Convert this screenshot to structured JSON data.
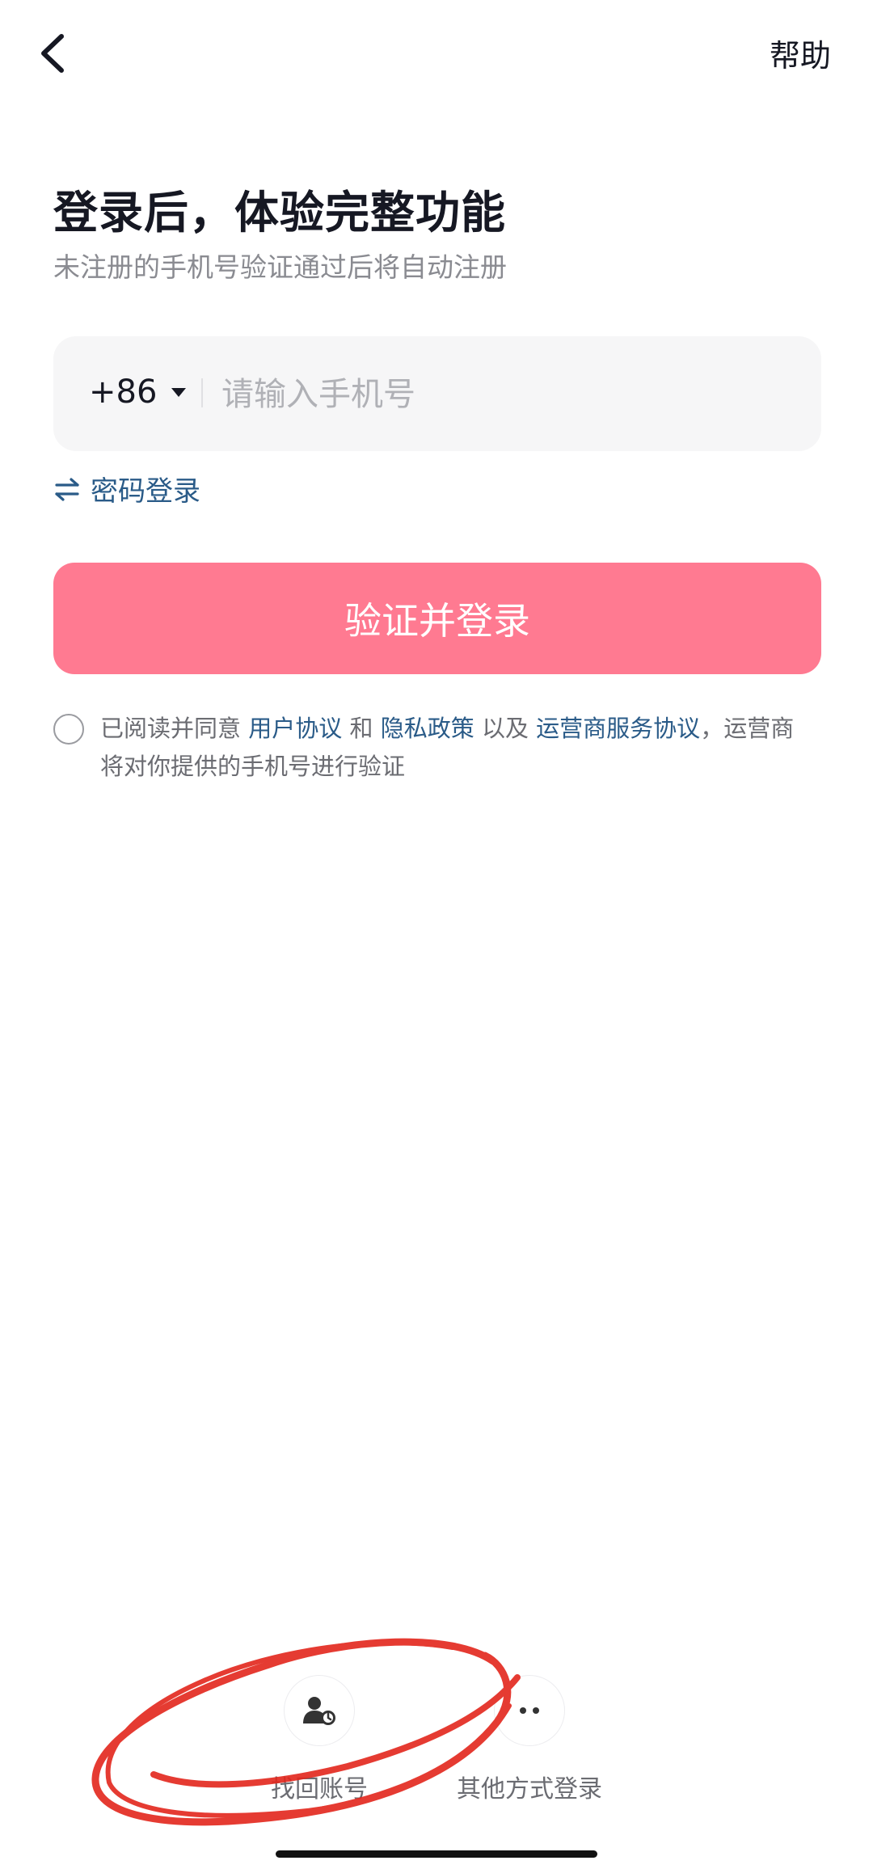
{
  "header": {
    "help_label": "帮助"
  },
  "title": "登录后，体验完整功能",
  "subtitle": "未注册的手机号验证通过后将自动注册",
  "phone": {
    "country_code": "+86",
    "placeholder": "请输入手机号",
    "value": ""
  },
  "password_login_label": "密码登录",
  "login_button_label": "验证并登录",
  "agreement": {
    "checked": false,
    "prefix": "已阅读并同意",
    "user_agreement": "用户协议",
    "and": "和",
    "privacy_policy": "隐私政策",
    "and_also": "以及",
    "operator_agreement": "运营商服务协议",
    "suffix": "，运营商将对你提供的手机号进行验证"
  },
  "bottom_options": {
    "recover_label": "找回账号",
    "other_label": "其他方式登录"
  },
  "colors": {
    "accent": "#ff7a91",
    "link": "#2a5b88",
    "annotation": "#e3261c"
  },
  "icons": [
    "back-arrow-icon",
    "dropdown-caret-icon",
    "swap-icon",
    "recover-account-icon",
    "more-icon"
  ]
}
